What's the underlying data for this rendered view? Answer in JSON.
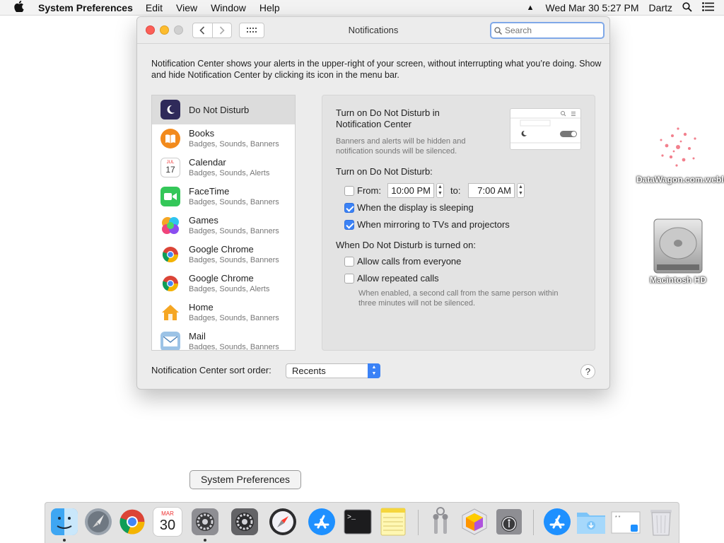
{
  "menubar": {
    "app_name": "System Preferences",
    "menus": [
      "Edit",
      "View",
      "Window",
      "Help"
    ],
    "clock": "Wed Mar 30  5:27 PM",
    "user": "Dartz"
  },
  "window": {
    "title": "Notifications",
    "search_placeholder": "Search",
    "description": "Notification Center shows your alerts in the upper-right of your screen, without interrupting what you’re doing. Show and hide Notification Center by clicking its icon in the menu bar."
  },
  "apps": [
    {
      "name": "Do Not Disturb",
      "sub": "",
      "icon": "moon-icon",
      "color": "#2f2a5a"
    },
    {
      "name": "Books",
      "sub": "Badges, Sounds, Banners",
      "icon": "books-icon",
      "color": "#f28a1c"
    },
    {
      "name": "Calendar",
      "sub": "Badges, Sounds, Alerts",
      "icon": "calendar-icon",
      "color": "#ffffff"
    },
    {
      "name": "FaceTime",
      "sub": "Badges, Sounds, Banners",
      "icon": "facetime-icon",
      "color": "#34c759"
    },
    {
      "name": "Games",
      "sub": "Badges, Sounds, Banners",
      "icon": "games-icon",
      "color": "#b44cf0"
    },
    {
      "name": "Google Chrome",
      "sub": "Badges, Sounds, Banners",
      "icon": "chrome-icon",
      "color": "#ffffff"
    },
    {
      "name": "Google Chrome",
      "sub": "Badges, Sounds, Alerts",
      "icon": "chrome-icon",
      "color": "#ffffff"
    },
    {
      "name": "Home",
      "sub": "Badges, Sounds, Banners",
      "icon": "home-icon",
      "color": "#f5a623"
    },
    {
      "name": "Mail",
      "sub": "Badges, Sounds, Banners",
      "icon": "mail-icon",
      "color": "#6aa3d8"
    }
  ],
  "dnd": {
    "title": "Turn on Do Not Disturb in Notification Center",
    "note": "Banners and alerts will be hidden and notification sounds will be silenced.",
    "turn_on_label": "Turn on Do Not Disturb:",
    "from_label": "From:",
    "from_time": "10:00 PM",
    "to_label": "to:",
    "to_time": "7:00 AM",
    "from_checked": false,
    "sleeping_label": "When the display is sleeping",
    "sleeping_checked": true,
    "mirroring_label": "When mirroring to TVs and projectors",
    "mirroring_checked": true,
    "when_on_label": "When Do Not Disturb is turned on:",
    "calls_label": "Allow calls from everyone",
    "calls_checked": false,
    "repeated_label": "Allow repeated calls",
    "repeated_checked": false,
    "repeated_note": "When enabled, a second call from the same person within three minutes will not be silenced."
  },
  "sort": {
    "label": "Notification Center sort order:",
    "value": "Recents"
  },
  "desktop": {
    "webloc_label": "DataWagon.com.webloc",
    "hd_label": "Macintosh HD"
  },
  "dock": {
    "tooltip": "System Preferences",
    "calendar_month": "MAR",
    "calendar_day": "30",
    "items": [
      "finder-icon",
      "launchpad-icon",
      "chrome-icon",
      "calendar-icon",
      "system-preferences-icon",
      "system-preferences-icon",
      "safari-icon",
      "app-store-icon",
      "terminal-icon",
      "notes-icon",
      "keychain-icon",
      "grapher-icon",
      "voiceover-icon",
      "app-store-icon",
      "downloads-folder-icon",
      "file-icon",
      "trash-icon"
    ]
  }
}
